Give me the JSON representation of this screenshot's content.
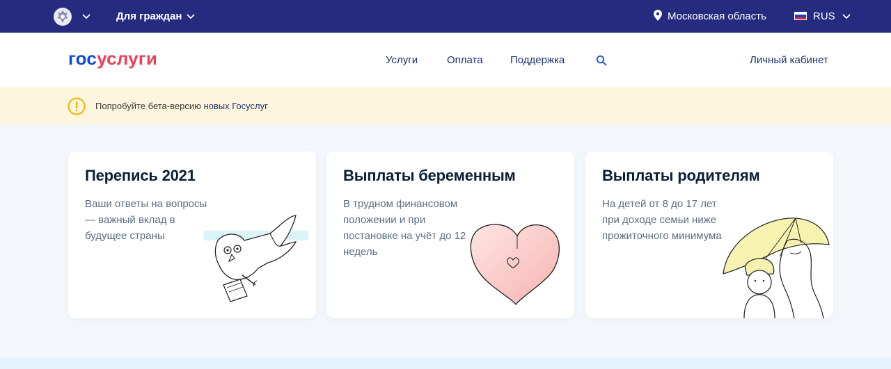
{
  "topbar": {
    "for_citizens": "Для граждан",
    "region": "Московская область",
    "language": "RUS"
  },
  "header": {
    "logo_part1": "гос",
    "logo_part2": "услуги",
    "nav": [
      "Услуги",
      "Оплата",
      "Поддержка"
    ],
    "cabinet": "Личный кабинет"
  },
  "banner": {
    "text": "Попробуйте бета-версию ",
    "link": "новых Госуслуг"
  },
  "cards": [
    {
      "title": "Перепись 2021",
      "desc": "Ваши ответы на вопросы — важный вклад в будущее страны",
      "illustration": "census-bird-illustration"
    },
    {
      "title": "Выплаты беременным",
      "desc": "В трудном финансовом положении и при постановке на учёт до 12 недель",
      "illustration": "heart-illustration"
    },
    {
      "title": "Выплаты родителям",
      "desc": "На детей от 8 до 17 лет при доходе семьи ниже прожиточного минимума",
      "illustration": "parent-umbrella-illustration"
    }
  ],
  "colors": {
    "topbar": "#252c80",
    "logo_blue": "#0d4cd3",
    "logo_red": "#ee3f58",
    "banner_bg": "#fdf5dd",
    "page_bg": "#f3f7fc",
    "warning": "#f2b500",
    "heart": "#f7b7b5"
  }
}
